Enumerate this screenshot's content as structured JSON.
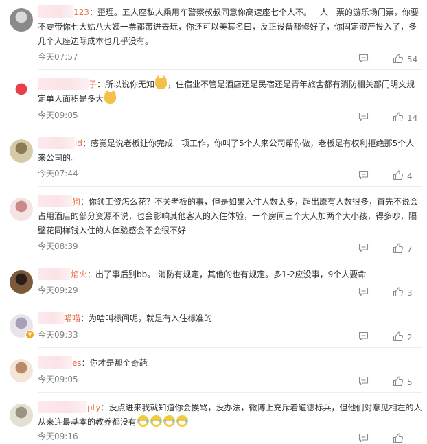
{
  "comments": [
    {
      "name_suffix": "123",
      "avatar_colors": [
        "#8a8a8a",
        "#d9d9d9"
      ],
      "segments": [
        {
          "t": "text",
          "v": "：歪理。五人座私人乘用车警察叔叔同意你高速座七个人不。一人一票的游乐场门票，你要不要带你七大姑八大姨一票都带进去玩，你还可以美其名曰，反正设备都修好了，你固定资产投入了，多几个人座边际成本也几乎没有。"
        }
      ],
      "time": "今天07:57",
      "likes": "54"
    },
    {
      "name_suffix": "子",
      "avatar_colors": [
        "#ffffff",
        "#e8404a"
      ],
      "segments": [
        {
          "t": "text",
          "v": "：所以说你无知"
        },
        {
          "t": "emoji",
          "icon": "cat-emoji-icon",
          "kind": "cat"
        },
        {
          "t": "text",
          "v": "，住宿业不管是酒店还是民宿还是青年旅舍都有消防相关部门明文规定单人面积是多大"
        },
        {
          "t": "emoji",
          "icon": "cat-emoji-icon",
          "kind": "cat"
        }
      ],
      "time": "今天09:05",
      "likes": "14"
    },
    {
      "name_suffix": "ld",
      "avatar_colors": [
        "#d6cba9",
        "#8a7a55"
      ],
      "segments": [
        {
          "t": "text",
          "v": "：感觉是说老板让你完成一项工作，你叫了5个人来公司帮你做，老板是有权利拒绝那5个人来公司的。"
        }
      ],
      "time": "今天07:44",
      "likes": "4"
    },
    {
      "name_suffix": "狗",
      "avatar_colors": [
        "#f6e4e4",
        "#c98a8a"
      ],
      "segments": [
        {
          "t": "text",
          "v": "：你领工资怎么花？不关老板的事，但是如果入住人数太多，超出原有人数很多，首先不说会占用酒店的部分资源不说，也会影响其他客人的入住体验，一个房间三个大人加两个大小孩，得多吵，隔壁花同样钱入住的人体验感会不会很不好"
        }
      ],
      "time": "今天08:39",
      "likes": "7"
    },
    {
      "name_suffix": "焰火",
      "avatar_colors": [
        "#7a5a3a",
        "#2a1f18"
      ],
      "segments": [
        {
          "t": "text",
          "v": "：出了事后别bb。 消防有规定，其他的也有规定。多1-2应没事，9个人要命"
        }
      ],
      "time": "今天09:29",
      "likes": "3"
    },
    {
      "name_suffix": "喵喵",
      "avatar_colors": [
        "#e9e4ea",
        "#a7a0b8"
      ],
      "vbadge": "v",
      "segments": [
        {
          "t": "text",
          "v": "：为啥叫标间呢，就是有入住标准的"
        }
      ],
      "time": "今天09:33",
      "likes": "2"
    },
    {
      "name_suffix": "es",
      "avatar_colors": [
        "#f3e6d8",
        "#b88a6a"
      ],
      "segments": [
        {
          "t": "text",
          "v": "：你才是那个奇葩"
        }
      ],
      "time": "今天09:05",
      "likes": "5"
    },
    {
      "name_suffix": "pty",
      "avatar_colors": [
        "#e4e0d4",
        "#9a9484"
      ],
      "segments": [
        {
          "t": "text",
          "v": "：没点进来我就知道你会挨骂，没办法，微博上充斥着道德标兵，但他们对意见相左的人从来连最基本的教养都没有"
        },
        {
          "t": "emoji",
          "icon": "laugh-emoji-icon",
          "kind": "laugh"
        },
        {
          "t": "emoji",
          "icon": "laugh-emoji-icon",
          "kind": "laugh"
        },
        {
          "t": "emoji",
          "icon": "laugh-emoji-icon",
          "kind": "laugh"
        },
        {
          "t": "emoji",
          "icon": "laugh-emoji-icon",
          "kind": "laugh"
        }
      ],
      "time": "今天09:16",
      "likes": ""
    }
  ],
  "icons": {
    "reply": "comment-icon",
    "like": "thumbs-up-icon"
  },
  "colors": {
    "username": "#eb7350",
    "meta": "#808080",
    "text": "#333333"
  }
}
